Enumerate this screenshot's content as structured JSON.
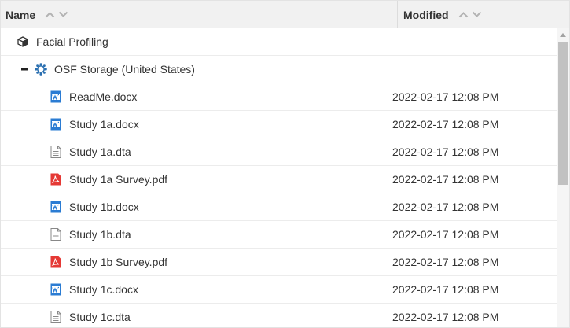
{
  "header": {
    "name_label": "Name",
    "modified_label": "Modified"
  },
  "project": {
    "label": "Facial Profiling",
    "icon": "cube-icon"
  },
  "storage": {
    "label": "OSF Storage (United States)",
    "icon": "osf-storage-icon",
    "expanded": true
  },
  "files": [
    {
      "name": "ReadMe.docx",
      "type": "docx",
      "modified": "2022-02-17 12:08 PM"
    },
    {
      "name": "Study 1a.docx",
      "type": "docx",
      "modified": "2022-02-17 12:08 PM"
    },
    {
      "name": "Study 1a.dta",
      "type": "dta",
      "modified": "2022-02-17 12:08 PM"
    },
    {
      "name": "Study 1a Survey.pdf",
      "type": "pdf",
      "modified": "2022-02-17 12:08 PM"
    },
    {
      "name": "Study 1b.docx",
      "type": "docx",
      "modified": "2022-02-17 12:08 PM"
    },
    {
      "name": "Study 1b.dta",
      "type": "dta",
      "modified": "2022-02-17 12:08 PM"
    },
    {
      "name": "Study 1b Survey.pdf",
      "type": "pdf",
      "modified": "2022-02-17 12:08 PM"
    },
    {
      "name": "Study 1c.docx",
      "type": "docx",
      "modified": "2022-02-17 12:08 PM"
    },
    {
      "name": "Study 1c.dta",
      "type": "dta",
      "modified": "2022-02-17 12:08 PM"
    }
  ],
  "colors": {
    "word": "#2b7cd3",
    "pdf": "#e53935",
    "generic": "#888888",
    "storage": "#2a6fb0"
  }
}
